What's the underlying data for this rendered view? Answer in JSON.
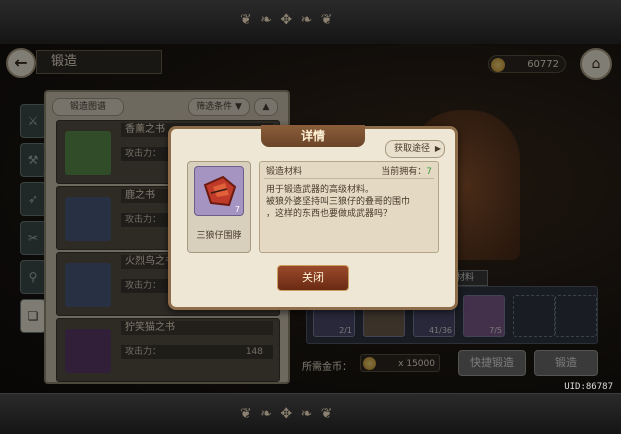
{
  "header": {
    "title": "锻造",
    "coins": "60772"
  },
  "list_panel": {
    "tab_label": "锻造图谱",
    "filter_label": "筛选条件",
    "items": [
      {
        "name": "香薰之书",
        "attack_label": "攻击力：",
        "attack_value": "",
        "thumb_color": "#5a8a4a"
      },
      {
        "name": "鹿之书",
        "attack_label": "攻击力：",
        "attack_value": "",
        "thumb_color": "#4a5a7a"
      },
      {
        "name": "火烈鸟之书",
        "attack_label": "攻击力：",
        "attack_value": "",
        "thumb_color": "#4a5a7a"
      },
      {
        "name": "狞笑猫之书",
        "attack_label": "攻击力：",
        "attack_value": "148",
        "thumb_color": "#5a3a6a"
      }
    ]
  },
  "forge": {
    "materials_label": "材料",
    "materials": [
      {
        "count": "2/1"
      },
      {
        "count": ""
      },
      {
        "count": "41/36"
      },
      {
        "count": "7/5"
      }
    ],
    "cost_label": "所需金币：",
    "cost_value": "x 15000",
    "quick_forge_label": "快捷锻造",
    "forge_label": "锻造"
  },
  "dialog": {
    "title": "详情",
    "source_label": "获取途径",
    "item_name": "三狼仔围脖",
    "item_count": "7",
    "type": "锻造材料",
    "owned_label": "当前拥有：",
    "owned_value": "7",
    "description": "用于锻造武器的高级材料。\n被狼外婆坚持叫三狼仔的叠哥的围巾\n，这样的东西也要做成武器吗？",
    "close_label": "关闭"
  },
  "uid": "UID:86787"
}
